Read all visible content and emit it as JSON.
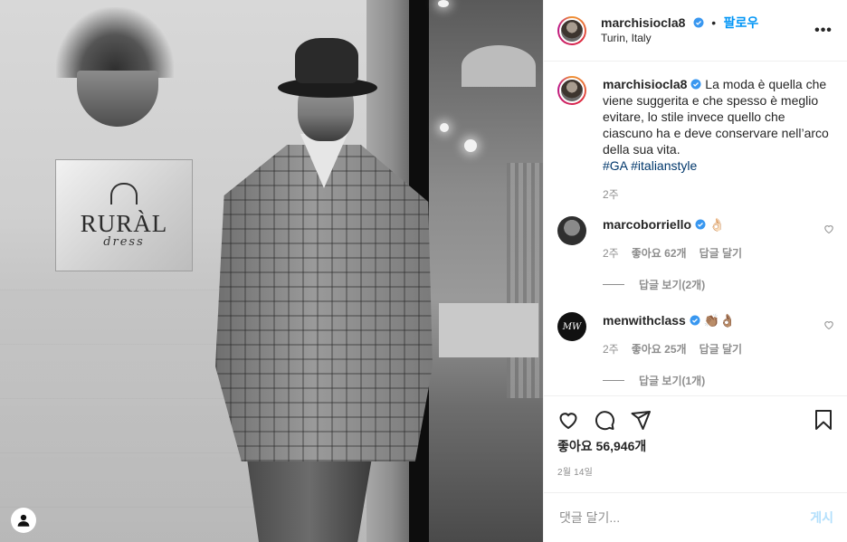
{
  "post": {
    "username": "marchisiocla8",
    "location": "Turin, Italy",
    "follow_label": "팔로우",
    "dot": "•",
    "more_label": "•••",
    "caption": "La moda è quella che viene suggerita e che spesso è meglio evitare, lo stile invece quello che ciascuno ha e deve conservare nell’arco della sua vita.",
    "hashtags": [
      "#GA",
      "#italianstyle"
    ],
    "caption_age": "2주",
    "likes_text": "좋아요 56,946개",
    "date": "2월 14일"
  },
  "photo": {
    "sign_title": "RURÀL",
    "sign_sub": "dress"
  },
  "comments": [
    {
      "username": "marcoborriello",
      "text": "👌🏻",
      "age": "2주",
      "likes": "좋아요 62개",
      "reply": "답글 달기",
      "view_replies": "답글 보기(2개)"
    },
    {
      "username": "menwithclass",
      "text": "👏🏽👌🏽",
      "age": "2주",
      "likes": "좋아요 25개",
      "reply": "답글 달기",
      "view_replies": "답글 보기(1개)"
    }
  ],
  "add_comment": {
    "placeholder": "댓글 달기...",
    "post_label": "게시"
  },
  "colors": {
    "accent": "#0095f6",
    "hashtag": "#00376b",
    "muted": "#8e8e8e",
    "post_disabled": "#b2dffc"
  }
}
